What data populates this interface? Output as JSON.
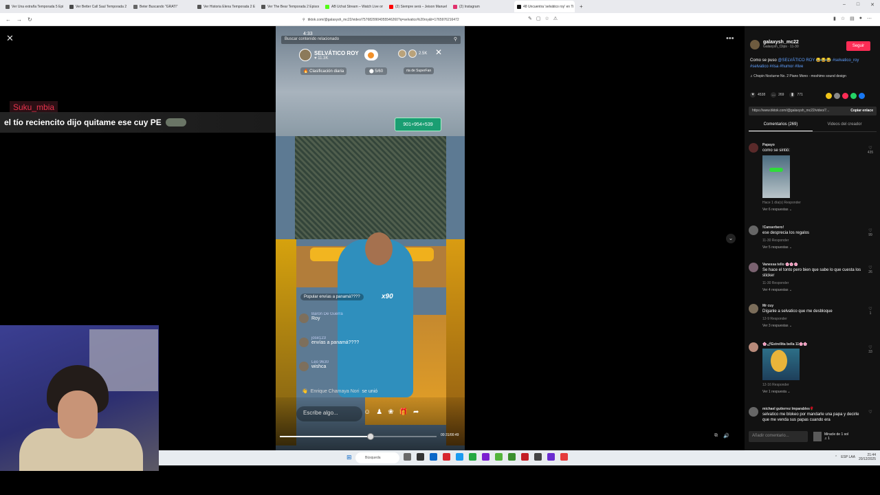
{
  "browser": {
    "tabs": [
      {
        "label": "Ver Una extraña Temporada 5 Episo",
        "color": "#5b5b5b",
        "active": false
      },
      {
        "label": "Ver Better Call Saul Temporada 2 Ep",
        "color": "#4a4a4a",
        "active": false
      },
      {
        "label": "Beter Buscando \"GRATI\"",
        "color": "#666",
        "active": false
      },
      {
        "label": "Ver Historia Elena Temporada 2 Episo",
        "color": "#555",
        "active": false
      },
      {
        "label": "Ver The Bear Temporada 2 Episodio",
        "color": "#555",
        "active": false
      },
      {
        "label": "AB Uchat Stream – Watch Live on Ki",
        "color": "#53fc18",
        "active": false
      },
      {
        "label": "(2) Siempre será – Jeison Manuel",
        "color": "#ff0000",
        "active": false
      },
      {
        "label": "(2) Instagram",
        "color": "#e1306c",
        "active": false
      },
      {
        "label": "48 Uncuentra 'selvático roy' en Ti",
        "color": "#111",
        "active": true
      }
    ],
    "new_tab": "+",
    "url": "tiktok.com/@galaxysh_mc22/video/7576829904055546260?q=selvatico%20roy&t=1765976216472",
    "window_controls": [
      "–",
      "□",
      "✕"
    ]
  },
  "page": {
    "close": "✕",
    "more": "•••",
    "nav_down": "⌄"
  },
  "overlay": {
    "username": "Suku_mbia",
    "message": "el tío reciencito dijo quitame ese cuy PE"
  },
  "video": {
    "status_time": "4:33",
    "search_placeholder": "Buscar contenido relacionado",
    "host_name": "SELVÁTICO ROY",
    "host_likes": "♥ 11.3K",
    "viewers": "2.5K",
    "rank_label": "Clasificación diaria",
    "rank_count": "5/60",
    "superfan": "rta de SuperFan",
    "sign_text": "901+954+539",
    "gift_text": "Popular envías a panamá????",
    "gift_mult": "x90",
    "comments": [
      {
        "user": "Baron De Guerra",
        "text": "Roy"
      },
      {
        "user": "jose123",
        "text": "envías a panamá????"
      },
      {
        "user": "Leo 9630",
        "text": "wishca"
      }
    ],
    "joined_user": "Enrique Chamaya Nori",
    "joined_text": "se unió",
    "input_placeholder": "Escribe algo...",
    "time": "00:31/00:49",
    "progress": 0.58
  },
  "sidebar": {
    "author_name": "galaxysh_mc22",
    "author_sub": "Galaxysh_Clips · 11-30",
    "follow_label": "Seguir",
    "description_prefix": "Como se puso ",
    "description_tags": "@SELVÁTICO ROY 😂😂😂 #selvatico_roy #selvatico #risa #humor #live",
    "music": "♫ Chopin Nocturne No. 2 Piano Mono - moshimo sound design",
    "stats": [
      {
        "icon": "heart-icon",
        "glyph": "♥",
        "value": "4538"
      },
      {
        "icon": "comment-icon",
        "glyph": "…",
        "value": "269"
      },
      {
        "icon": "bookmark-icon",
        "glyph": "▮",
        "value": "771"
      }
    ],
    "share_colors": [
      "#f0c419",
      "#888",
      "#fe2c55",
      "#25d366",
      "#1877f2"
    ],
    "link": "https://www.tiktok.com/@galaxysh_mc22/video/7...",
    "copy_label": "Copiar enlace",
    "tabs": [
      "Comentarios (269)",
      "Videos del creador"
    ],
    "comments": [
      {
        "user": "Papayo",
        "text": "como se sintió:",
        "meta": "Hace 1 día(s)   Responder",
        "more": "Ver 6 respuestas ⌄",
        "likes": "435"
      },
      {
        "user": "!Canserbero!",
        "text": "ese desprecia los regalos",
        "meta": "11-30   Responder",
        "more": "Ver 5 respuestas ⌄",
        "likes": "99"
      },
      {
        "user": "Vanessa tello 🌸🌸🌸",
        "text": "Se hace el tonto pero bien que sabe lo que cuesta los sticker",
        "meta": "11-30   Responder",
        "more": "Ver 4 respuestas ⌄",
        "likes": "26"
      },
      {
        "user": "Mr cuy",
        "text": "Díganle a selvatico que me desbloque",
        "meta": "12-9   Responder",
        "more": "Ver 3 respuestas ⌄",
        "likes": "1"
      },
      {
        "user": "🌸🌶Estrellita bella 11🌸🌸",
        "text": "",
        "meta": "12-16   Responder",
        "more": "Ver 1 respuesta ⌄",
        "likes": "33"
      },
      {
        "user": "michael gutierrez Imparables🌹",
        "text": "selvatico me blokeo por mandarle una papa y decirle que me venda sus papas cuando era",
        "meta": "",
        "more": "",
        "likes": ""
      }
    ],
    "add_comment": "Añadir comentario...",
    "mini_title": "Miracle de 1 sol",
    "mini_sub": "♫ 1"
  },
  "taskbar": {
    "search": "Búsqueda",
    "start": "⊞",
    "app_colors": [
      "#6a6a6a",
      "#333",
      "#0a67c8",
      "#d7262f",
      "#1d9bf0",
      "#25a842",
      "#7a1fd0",
      "#53b53b",
      "#3b8f2e",
      "#c41e24",
      "#444",
      "#6a2cd0",
      "#e53b3b"
    ],
    "tray": "ESP LAA",
    "clock_time": "21:44",
    "clock_date": "20/12/2025"
  }
}
